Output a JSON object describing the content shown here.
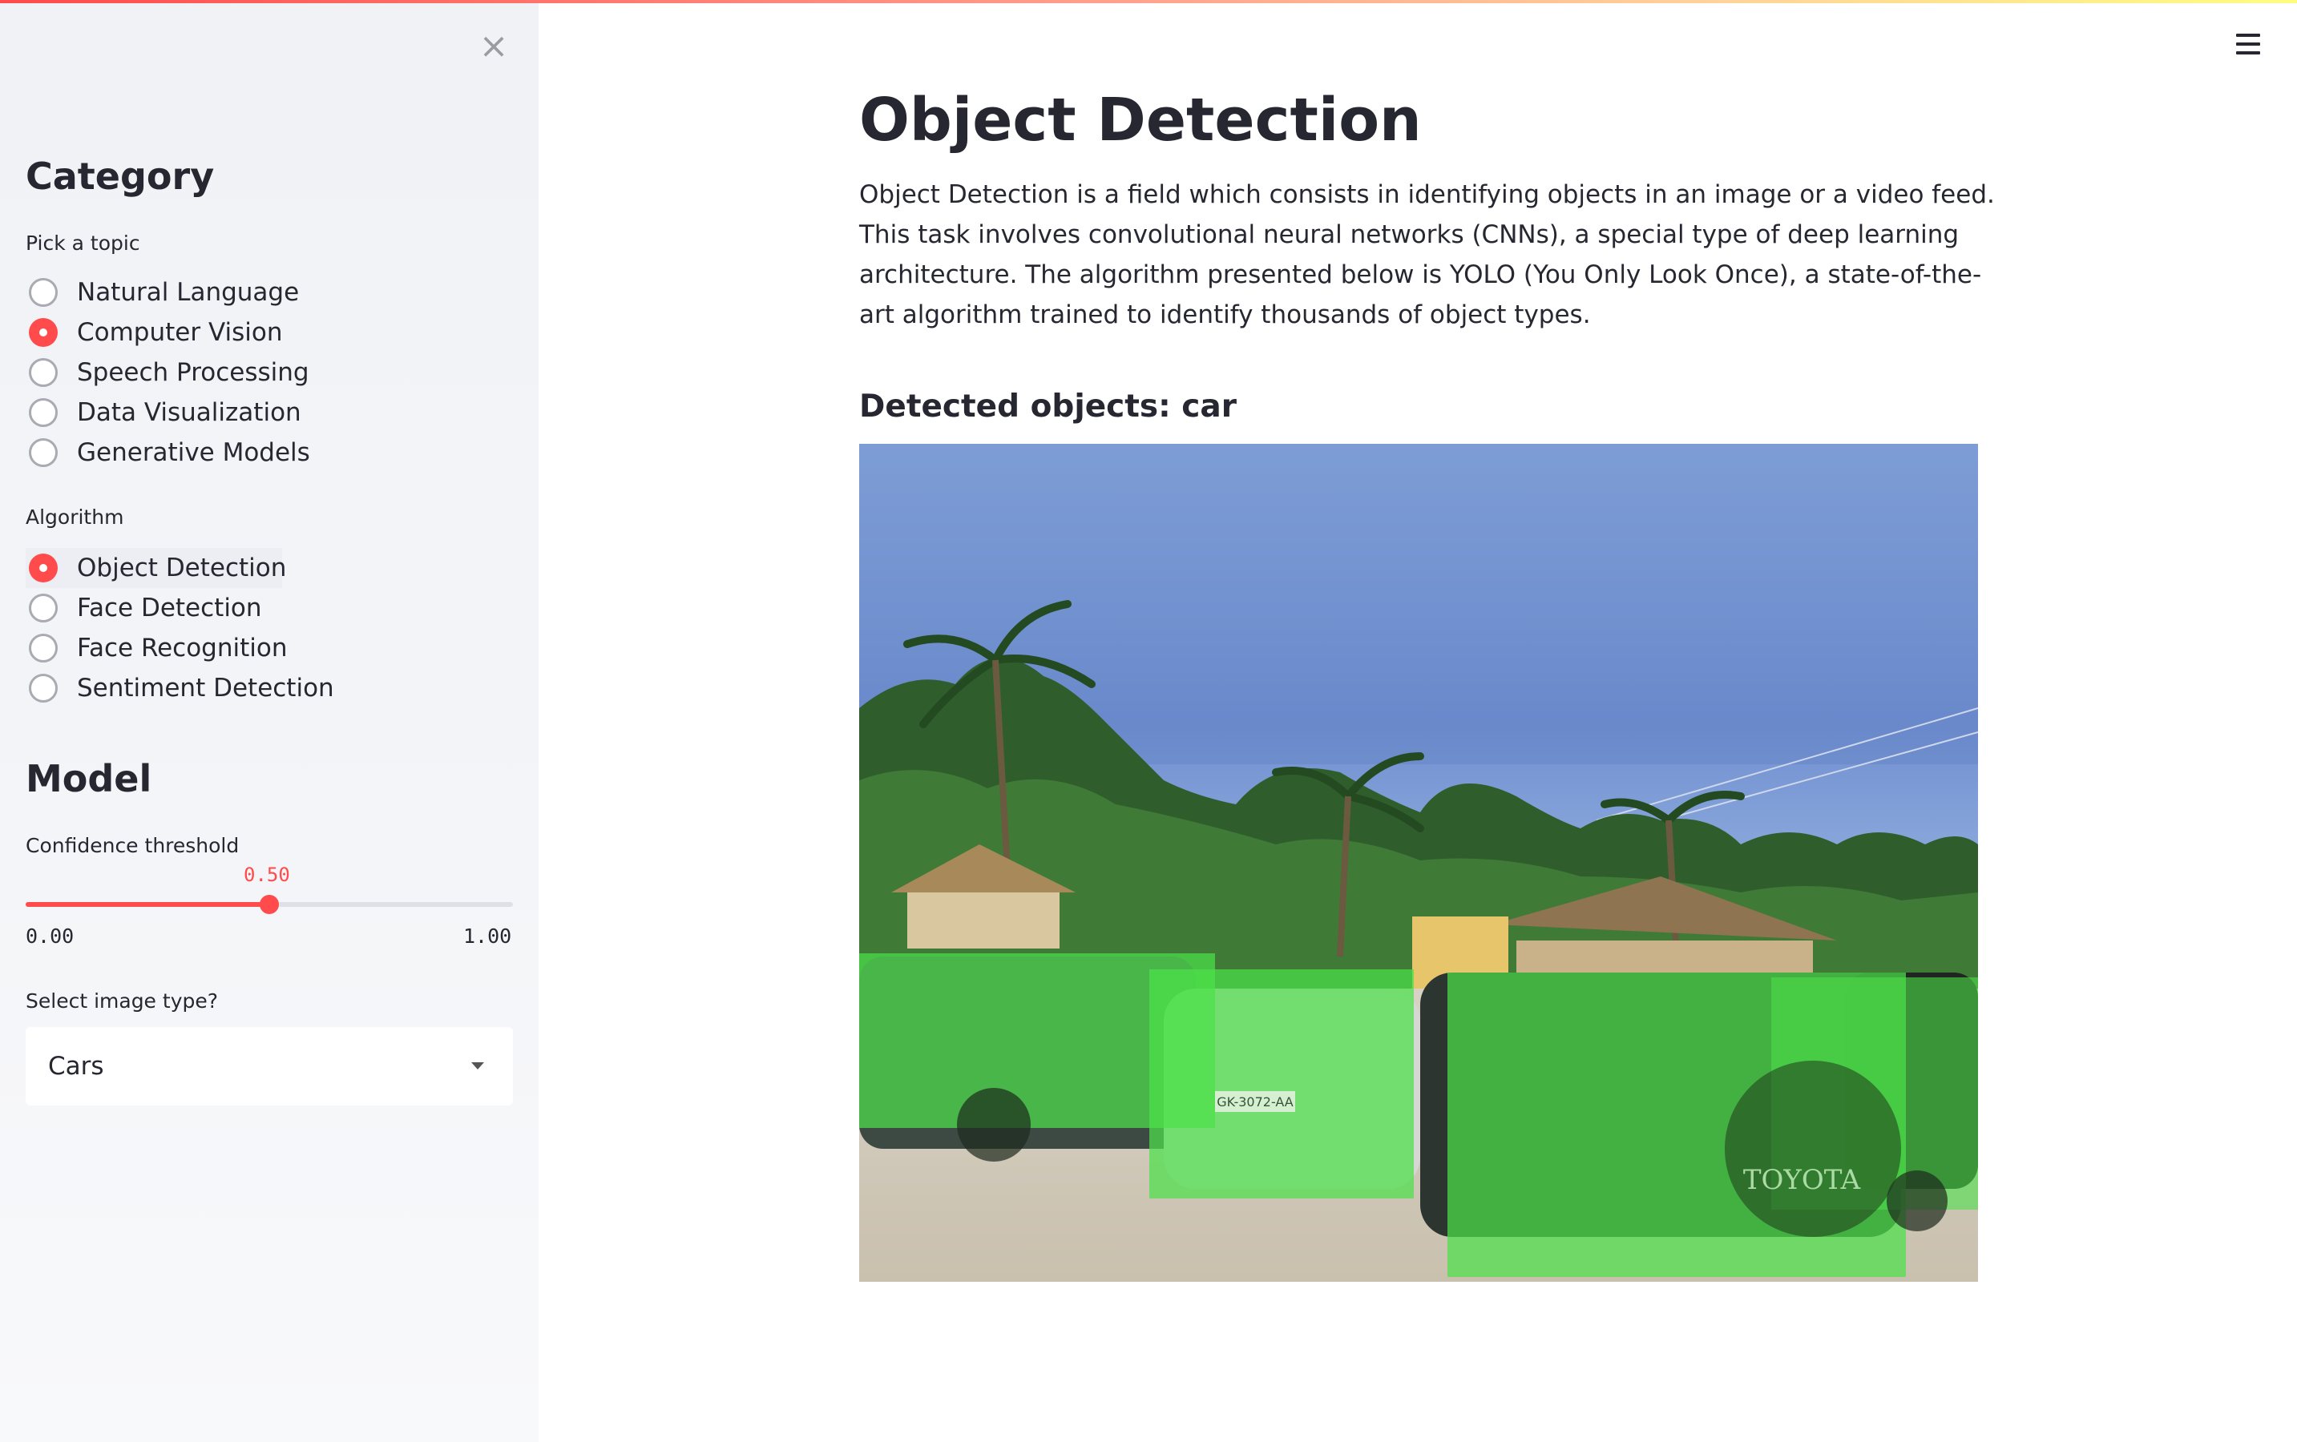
{
  "sidebar": {
    "close_label": "×",
    "category": {
      "heading": "Category",
      "topic_label": "Pick a topic",
      "topics": [
        {
          "label": "Natural Language",
          "selected": false
        },
        {
          "label": "Computer Vision",
          "selected": true
        },
        {
          "label": "Speech Processing",
          "selected": false
        },
        {
          "label": "Data Visualization",
          "selected": false
        },
        {
          "label": "Generative Models",
          "selected": false
        }
      ],
      "algorithm_label": "Algorithm",
      "algorithms": [
        {
          "label": "Object Detection",
          "selected": true
        },
        {
          "label": "Face Detection",
          "selected": false
        },
        {
          "label": "Face Recognition",
          "selected": false
        },
        {
          "label": "Sentiment Detection",
          "selected": false
        }
      ]
    },
    "model": {
      "heading": "Model",
      "confidence_label": "Confidence threshold",
      "confidence_value": "0.50",
      "confidence_fraction": 0.5,
      "confidence_min": "0.00",
      "confidence_max": "1.00",
      "image_type_label": "Select image type?",
      "image_type_value": "Cars"
    }
  },
  "main": {
    "title": "Object Detection",
    "description": "Object Detection is a field which consists in identifying objects in an image or a video feed. This task involves convolutional neural networks (CNNs), a special type of deep learning architecture. The algorithm presented below is YOLO (You Only Look Once), a state-of-the-art algorithm trained to identify thousands of object types.",
    "detected_heading": "Detected objects: car",
    "plate_text": "GK-3072-AA",
    "logo_text": "TOYOTA"
  },
  "colors": {
    "accent": "#ff4b4b",
    "detection_box": "#4ce04a",
    "sidebar_bg": "#f0f2f6",
    "text": "#262730"
  },
  "icons": {
    "close": "close-icon",
    "menu": "hamburger-menu-icon",
    "dropdown": "chevron-down-icon"
  }
}
